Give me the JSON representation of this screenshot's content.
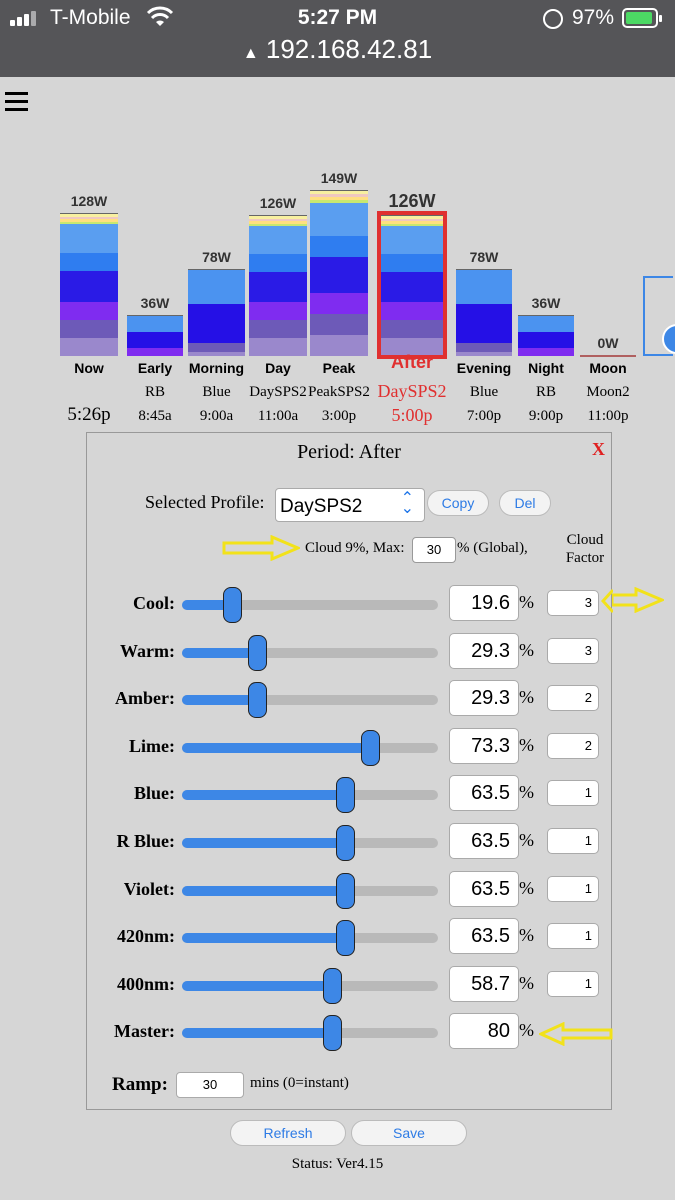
{
  "statusbar": {
    "carrier": "T-Mobile",
    "time": "5:27 PM",
    "battery": "97%",
    "url": "192.168.42.81"
  },
  "periods": [
    {
      "name": "Now",
      "watts": "128W",
      "profile": "",
      "time": "5:26p",
      "selected": false
    },
    {
      "name": "Early",
      "watts": "36W",
      "profile": "RB",
      "time": "8:45a",
      "selected": false
    },
    {
      "name": "Morning",
      "watts": "78W",
      "profile": "Blue",
      "time": "9:00a",
      "selected": false
    },
    {
      "name": "Day",
      "watts": "126W",
      "profile": "DaySPS2",
      "time": "11:00a",
      "selected": false
    },
    {
      "name": "Peak",
      "watts": "149W",
      "profile": "PeakSPS2",
      "time": "3:00p",
      "selected": false
    },
    {
      "name": "After",
      "watts": "126W",
      "profile": "DaySPS2",
      "time": "5:00p",
      "selected": true
    },
    {
      "name": "Evening",
      "watts": "78W",
      "profile": "Blue",
      "time": "7:00p",
      "selected": false
    },
    {
      "name": "Night",
      "watts": "36W",
      "profile": "RB",
      "time": "9:00p",
      "selected": false
    },
    {
      "name": "Moon",
      "watts": "0W",
      "profile": "Moon2",
      "time": "11:00p",
      "selected": false
    }
  ],
  "panel": {
    "title": "Period: After",
    "close": "X",
    "profile_label": "Selected Profile:",
    "profile_value": "DaySPS2",
    "copy": "Copy",
    "del": "Del",
    "cloud_text": "Cloud 9%, Max:",
    "cloud_max": "30",
    "cloud_global": "% (Global),",
    "cloud_factor_header": "Cloud Factor",
    "channels": [
      {
        "label": "Cool:",
        "value": "19.6",
        "pct": 19.6,
        "unit": "%",
        "cloud": "3"
      },
      {
        "label": "Warm:",
        "value": "29.3",
        "pct": 29.3,
        "unit": "%",
        "cloud": "3"
      },
      {
        "label": "Amber:",
        "value": "29.3",
        "pct": 29.3,
        "unit": "%",
        "cloud": "2"
      },
      {
        "label": "Lime:",
        "value": "73.3",
        "pct": 73.3,
        "unit": "%",
        "cloud": "2"
      },
      {
        "label": "Blue:",
        "value": "63.5",
        "pct": 63.5,
        "unit": "%",
        "cloud": "1"
      },
      {
        "label": "R Blue:",
        "value": "63.5",
        "pct": 63.5,
        "unit": "%",
        "cloud": "1"
      },
      {
        "label": "Violet:",
        "value": "63.5",
        "pct": 63.5,
        "unit": "%",
        "cloud": "1"
      },
      {
        "label": "420nm:",
        "value": "63.5",
        "pct": 63.5,
        "unit": "%",
        "cloud": "1"
      },
      {
        "label": "400nm:",
        "value": "58.7",
        "pct": 58.7,
        "unit": "%",
        "cloud": "1"
      },
      {
        "label": "Master:",
        "value": "80",
        "pct": 58.5,
        "unit": "%",
        "cloud": null
      }
    ],
    "ramp_label": "Ramp:",
    "ramp_value": "30",
    "ramp_text": "mins (0=instant)"
  },
  "buttons": {
    "refresh": "Refresh",
    "save": "Save"
  },
  "status": "Status: Ver4.15",
  "colors": {
    "accent": "#3d87e6",
    "selected": "#e03030",
    "arrow": "#f2e21a"
  }
}
